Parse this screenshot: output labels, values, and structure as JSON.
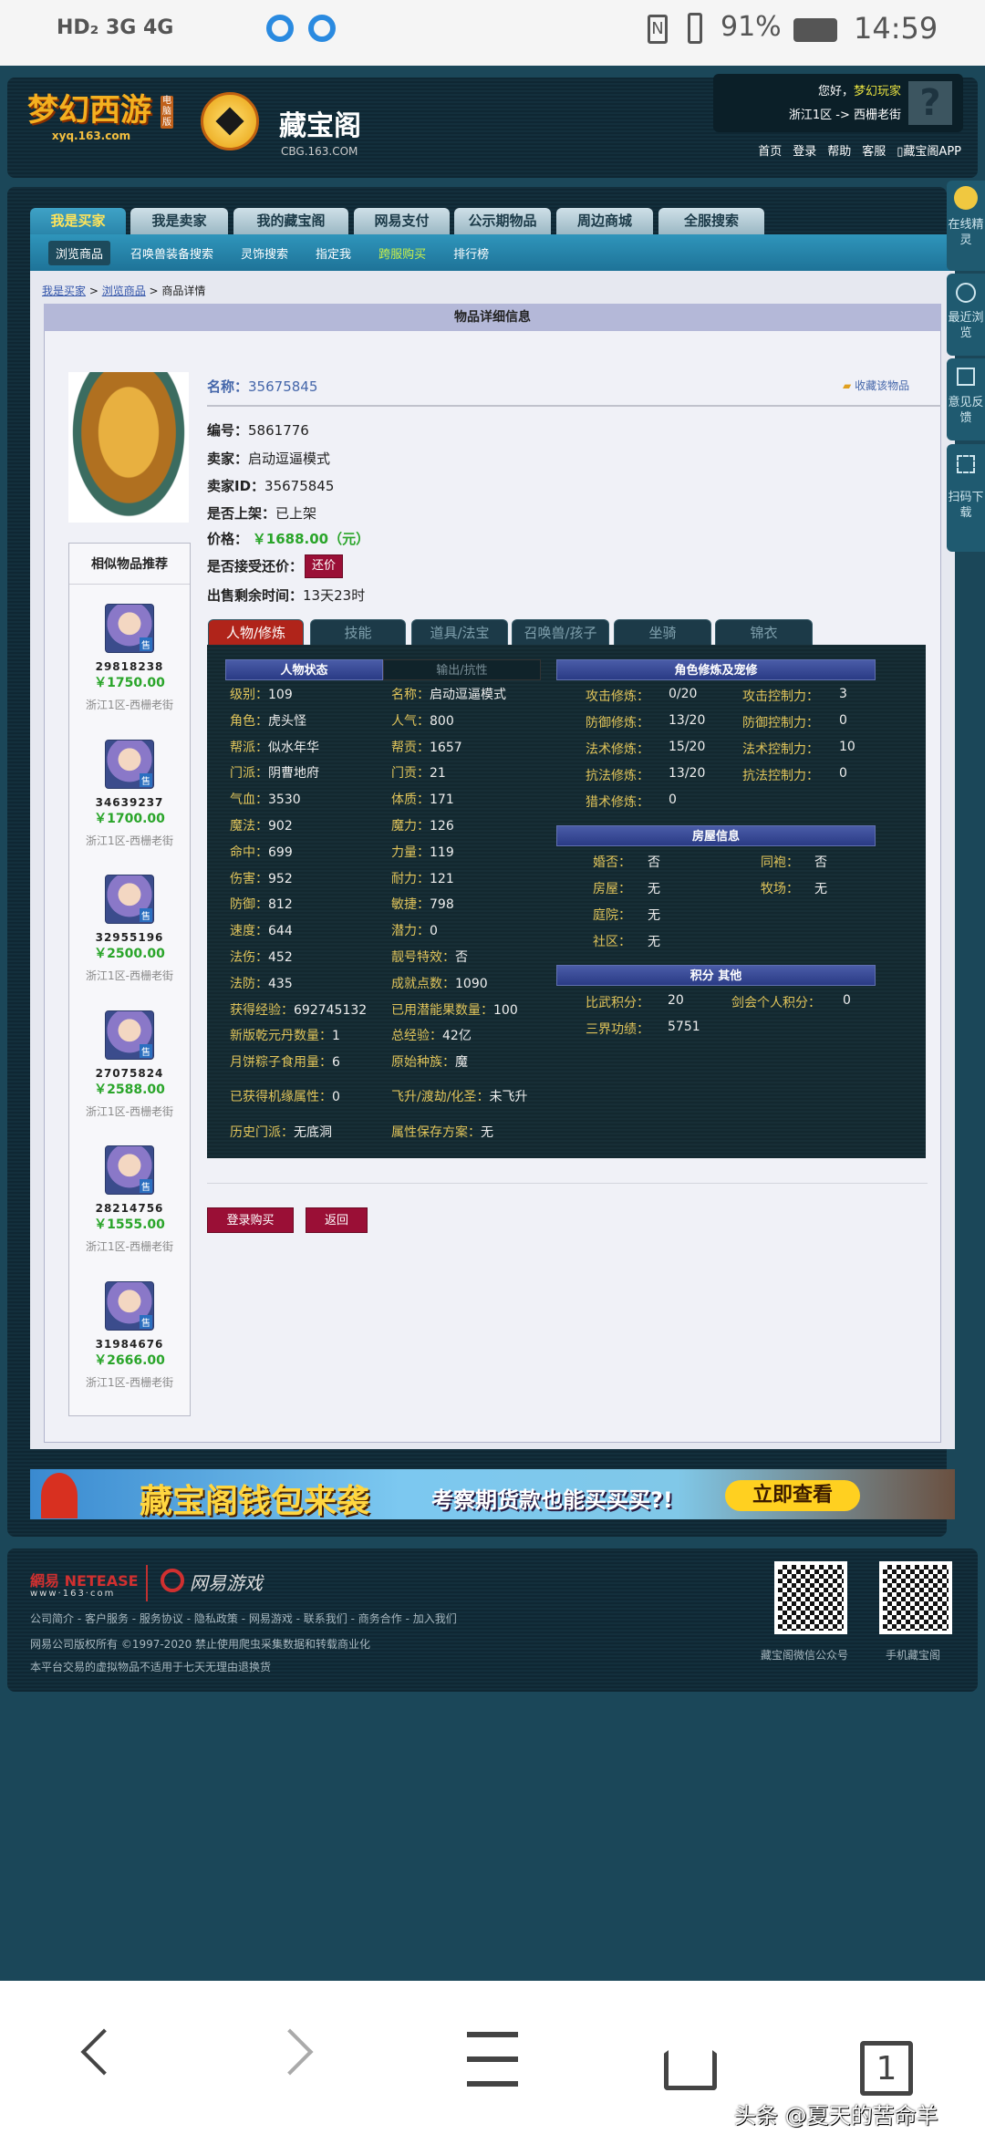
{
  "status_bar": {
    "left": "HD₂ 3G 4G",
    "battery": "91%",
    "time": "14:59"
  },
  "header": {
    "logo1": "梦幻西游",
    "logo1_sub": "xyq.163.com",
    "logo1_badge": "电脑版",
    "logo2": "藏宝阁",
    "logo2_sub": "CBG.163.COM",
    "greeting": "您好，",
    "user": "梦幻玩家",
    "server": "浙江1区 -> 西栅老街",
    "links": [
      "首页",
      "登录",
      "帮助",
      "客服",
      "藏宝阁APP"
    ]
  },
  "main_tabs": [
    "我是买家",
    "我是卖家",
    "我的藏宝阁",
    "网易支付",
    "公示期物品",
    "周边商城",
    "全服搜索"
  ],
  "sub_nav": [
    "浏览商品",
    "召唤兽装备搜索",
    "灵饰搜索",
    "指定我",
    "跨服购买",
    "排行榜"
  ],
  "breadcrumb": [
    "我是买家",
    "浏览商品",
    "商品详情"
  ],
  "panel_title": "物品详细信息",
  "item": {
    "name_label": "名称：",
    "name": "35675845",
    "favorite": "收藏该物品",
    "fields": [
      [
        "编号：",
        "5861776"
      ],
      [
        "卖家：",
        "启动逗逼模式"
      ],
      [
        "卖家ID：",
        "35675845"
      ],
      [
        "是否上架：",
        "已上架"
      ]
    ],
    "price_label": "价格：",
    "price": "￥1688.00（元）",
    "bargain_label": "是否接受还价：",
    "bargain_btn": "还价",
    "remaining_label": "出售剩余时间：",
    "remaining": "13天23时"
  },
  "recommend": {
    "title": "相似物品推荐",
    "badge": "售",
    "items": [
      {
        "id": "29818238",
        "price": "￥1750.00",
        "server": "浙江1区-西栅老街"
      },
      {
        "id": "34639237",
        "price": "￥1700.00",
        "server": "浙江1区-西栅老街"
      },
      {
        "id": "32955196",
        "price": "￥2500.00",
        "server": "浙江1区-西栅老街"
      },
      {
        "id": "27075824",
        "price": "￥2588.00",
        "server": "浙江1区-西栅老街"
      },
      {
        "id": "28214756",
        "price": "￥1555.00",
        "server": "浙江1区-西栅老街"
      },
      {
        "id": "31984676",
        "price": "￥2666.00",
        "server": "浙江1区-西栅老街"
      }
    ]
  },
  "detail_tabs": [
    "人物/修炼",
    "技能",
    "道具/法宝",
    "召唤兽/孩子",
    "坐骑",
    "锦衣"
  ],
  "stats": {
    "tab_a": "人物状态",
    "tab_b": "输出/抗性",
    "col1": [
      [
        "级别",
        "109"
      ],
      [
        "角色",
        "虎头怪"
      ],
      [
        "帮派",
        "似水年华"
      ],
      [
        "门派",
        "阴曹地府"
      ],
      [
        "气血",
        "3530"
      ],
      [
        "魔法",
        "902"
      ],
      [
        "命中",
        "699"
      ],
      [
        "伤害",
        "952"
      ],
      [
        "防御",
        "812"
      ],
      [
        "速度",
        "644"
      ],
      [
        "法伤",
        "452"
      ],
      [
        "法防",
        "435"
      ],
      [
        "获得经验",
        "692745132"
      ],
      [
        "新版乾元丹数量",
        "1"
      ],
      [
        "月饼粽子食用量",
        "6"
      ],
      [
        "已获得机缘属性",
        "0"
      ],
      [
        "历史门派",
        "无底洞"
      ]
    ],
    "col2": [
      [
        "名称",
        "启动逗逼模式"
      ],
      [
        "人气",
        "800"
      ],
      [
        "帮贡",
        "1657"
      ],
      [
        "门贡",
        "21"
      ],
      [
        "体质",
        "171"
      ],
      [
        "魔力",
        "126"
      ],
      [
        "力量",
        "119"
      ],
      [
        "耐力",
        "121"
      ],
      [
        "敏捷",
        "798"
      ],
      [
        "潜力",
        "0"
      ],
      [
        "靓号特效",
        "否"
      ],
      [
        "成就点数",
        "1090"
      ],
      [
        "已用潜能果数量",
        "100"
      ],
      [
        "总经验",
        "42亿"
      ],
      [
        "原始种族",
        "魔"
      ],
      [
        "飞升/渡劫/化圣",
        "未飞升"
      ],
      [
        "属性保存方案",
        "无"
      ]
    ],
    "cult_title": "角色修炼及宠修",
    "cult": [
      [
        "攻击修炼：",
        "0/20",
        "攻击控制力：",
        "3"
      ],
      [
        "防御修炼：",
        "13/20",
        "防御控制力：",
        "0"
      ],
      [
        "法术修炼：",
        "15/20",
        "法术控制力：",
        "10"
      ],
      [
        "抗法修炼：",
        "13/20",
        "抗法控制力：",
        "0"
      ],
      [
        "猎术修炼：",
        "0",
        "",
        ""
      ]
    ],
    "house_title": "房屋信息",
    "house": [
      [
        "婚否：",
        "否",
        "同袍：",
        "否"
      ],
      [
        "房屋：",
        "无",
        "牧场：",
        "无"
      ],
      [
        "庭院：",
        "无",
        "",
        ""
      ],
      [
        "社区：",
        "无",
        "",
        ""
      ]
    ],
    "score_title": "积分 其他",
    "score": [
      [
        "比武积分：",
        "20",
        "剑会个人积分：",
        "0"
      ],
      [
        "三界功绩：",
        "5751",
        "",
        ""
      ]
    ]
  },
  "actions": {
    "buy": "登录购买",
    "back": "返回"
  },
  "banner": {
    "title": "藏宝阁钱包来袭",
    "subtitle": "考察期货款也能买买买?!",
    "cta": "立即查看"
  },
  "footer": {
    "netease": "網易 NETEASE",
    "netease_url": "www·163·com",
    "games": "网易游戏",
    "links": "公司简介 - 客户服务 - 服务协议 - 隐私政策 - 网易游戏 - 联系我们 - 商务合作 - 加入我们",
    "copyright": "网易公司版权所有 ©1997-2020 禁止使用爬虫采集数据和转载商业化",
    "notice": "本平台交易的虚拟物品不适用于七天无理由退换货",
    "qr1": "藏宝阁微信公众号",
    "qr2": "手机藏宝阁"
  },
  "side_float": [
    "在线精灵",
    "最近浏览",
    "意见反馈",
    "扫码下载"
  ],
  "navbar": {
    "tabs_count": "1",
    "watermark": "头条 @夏天的苦命羊"
  },
  "colors": {
    "accent_yellow": "#e0c45a",
    "price_green": "#2aa52a",
    "button_red": "#9a0f36",
    "active_tab_red": "#b0241a"
  }
}
